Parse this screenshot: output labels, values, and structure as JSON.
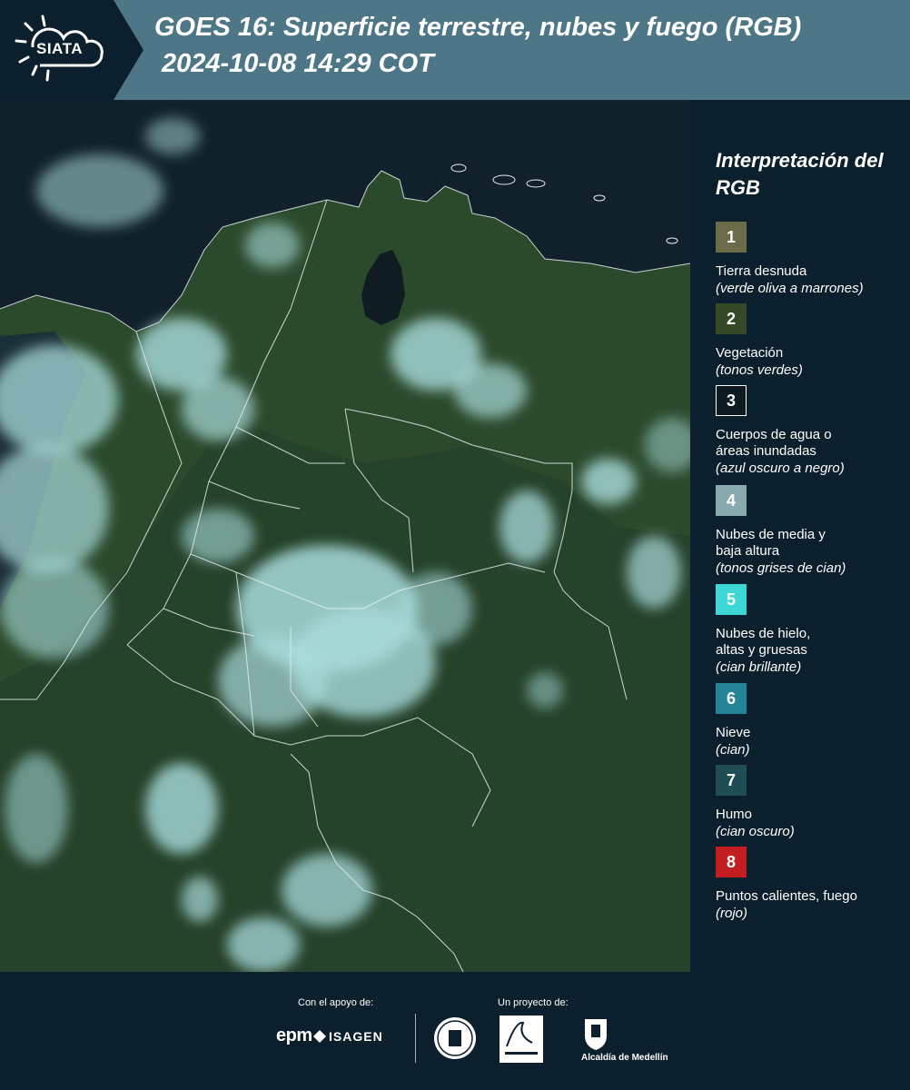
{
  "header": {
    "logo_text": "SIATA",
    "title_line1": "GOES 16: Superficie terrestre, nubes y fuego (RGB)",
    "title_line2": "2024-10-08 14:29 COT"
  },
  "legend": {
    "title": "Interpretación del RGB",
    "items": [
      {
        "number": "1",
        "label": "Tierra desnuda",
        "desc": "(verde oliva a marrones)",
        "color": "#6b6a49"
      },
      {
        "number": "2",
        "label": "Vegetación",
        "desc": "(tonos verdes)",
        "color": "#344a26"
      },
      {
        "number": "3",
        "label": "Cuerpos de agua o áreas inundadas",
        "desc": "(azul oscuro a negro)",
        "color": "#0e1a21"
      },
      {
        "number": "4",
        "label": "Nubes de media y baja altura",
        "desc": "(tonos grises de cian)",
        "color": "#89aaad"
      },
      {
        "number": "5",
        "label": "Nubes de hielo, altas y gruesas",
        "desc": "(cian brillante)",
        "color": "#3fd7d6"
      },
      {
        "number": "6",
        "label": "Nieve",
        "desc": "(cian)",
        "color": "#258598"
      },
      {
        "number": "7",
        "label": "Humo",
        "desc": "(cian oscuro)",
        "color": "#1f4f55"
      },
      {
        "number": "8",
        "label": "Puntos calientes, fuego",
        "desc": "(rojo)",
        "color": "#c21e21"
      }
    ]
  },
  "footer": {
    "support_label": "Con el apoyo de:",
    "project_label": "Un proyecto de:",
    "sponsor1": "epm",
    "sponsor2": "ISAGEN",
    "partner_area": "Área Metropolitana Valle de Aburrá",
    "partner_alcaldia": "Alcaldía de Medellín"
  },
  "colors": {
    "header_bg": "#4d7686",
    "panel_bg": "#0c1f2c",
    "vegetation": "#2c4a2a",
    "cloud": "#a9dcdc"
  }
}
